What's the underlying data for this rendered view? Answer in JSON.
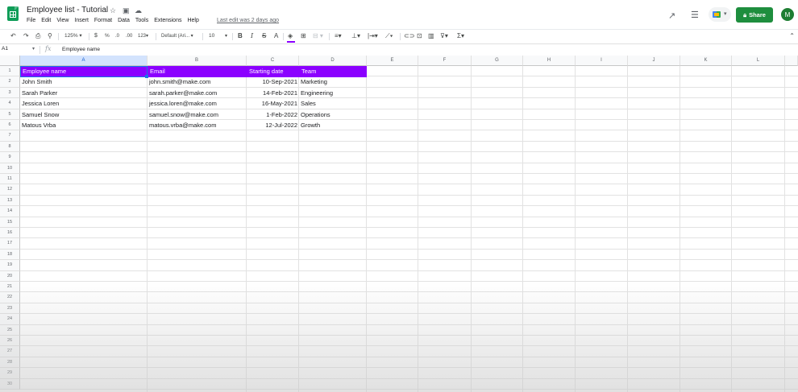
{
  "app": {
    "doc_title": "Employee list - Tutorial",
    "last_edit": "Last edit was 2 days ago",
    "share_label": "Share",
    "avatar_initial": "M",
    "menu": [
      "File",
      "Edit",
      "View",
      "Insert",
      "Format",
      "Data",
      "Tools",
      "Extensions",
      "Help"
    ],
    "brand_color": "#0f9d58",
    "share_color": "#1e8e3e"
  },
  "toolbar": {
    "zoom": "125%",
    "currency": "$",
    "percent": "%",
    "decimal_decrease": ".0",
    "decimal_increase": ".00",
    "number_format": "123",
    "font": "Default (Ari...",
    "font_size": "10",
    "bold": "B",
    "italic": "I",
    "strike": "S",
    "text_color": "A",
    "fill_color": "#8b00ff"
  },
  "formula": {
    "cell_ref": "A1",
    "fx": "fx",
    "content": "Employee name"
  },
  "columns": [
    "A",
    "B",
    "C",
    "D",
    "E",
    "F",
    "G",
    "H",
    "I",
    "J",
    "K",
    "L"
  ],
  "rows": [
    "1",
    "2",
    "3",
    "4",
    "5",
    "6",
    "7",
    "8",
    "9",
    "10",
    "11",
    "12",
    "13",
    "14",
    "15",
    "16",
    "17",
    "18",
    "19",
    "20",
    "21",
    "22",
    "23",
    "24",
    "25",
    "26",
    "27",
    "28",
    "29",
    "30"
  ],
  "sheet": {
    "header_color": "#8b00ff",
    "headers": [
      "Employee name",
      "Email",
      "Starting date",
      "Team"
    ],
    "records": [
      {
        "name": "John Smith",
        "email": "john.smith@make.com",
        "date": "10-Sep-2021",
        "team": "Marketing"
      },
      {
        "name": "Sarah Parker",
        "email": "sarah.parker@make.com",
        "date": "14-Feb-2021",
        "team": "Engineering"
      },
      {
        "name": "Jessica Loren",
        "email": "jessica.loren@make.com",
        "date": "16-May-2021",
        "team": "Sales"
      },
      {
        "name": "Samuel Snow",
        "email": "samuel.snow@make.com",
        "date": "1-Feb-2022",
        "team": "Operations"
      },
      {
        "name": "Matous Vrba",
        "email": "matous.vrba@make.com",
        "date": "12-Jul-2022",
        "team": "Growth"
      }
    ]
  }
}
